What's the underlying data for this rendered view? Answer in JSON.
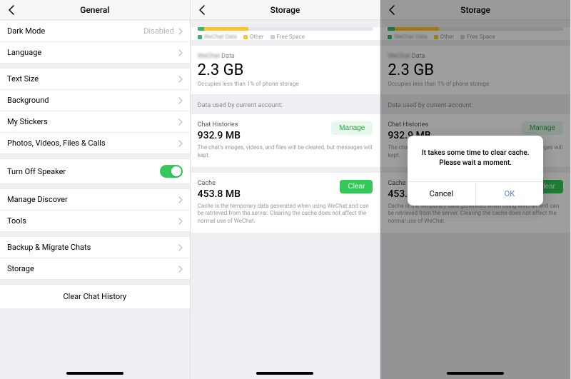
{
  "general": {
    "title": "General",
    "rows": {
      "darkMode": {
        "label": "Dark Mode",
        "value": "Disabled"
      },
      "language": {
        "label": "Language"
      },
      "textSize": {
        "label": "Text Size"
      },
      "background": {
        "label": "Background"
      },
      "myStickers": {
        "label": "My Stickers"
      },
      "photos": {
        "label": "Photos, Videos, Files & Calls"
      },
      "turnOffSpeaker": {
        "label": "Turn Off Speaker",
        "on": true
      },
      "manageDiscover": {
        "label": "Manage Discover"
      },
      "tools": {
        "label": "Tools"
      },
      "backup": {
        "label": "Backup & Migrate Chats"
      },
      "storage": {
        "label": "Storage"
      },
      "clearHistory": {
        "label": "Clear Chat History"
      }
    }
  },
  "storage": {
    "title": "Storage",
    "legend": {
      "app": "WeChat Data",
      "other": "Other",
      "free": "Free Space"
    },
    "dataTitlePrefix": "WeChat",
    "dataTitleSuffix": " Data",
    "total": "2.3 GB",
    "totalSub": "Occupies less than 1% of phone storage",
    "sectionHeader": "Data used by current account:",
    "chat": {
      "name": "Chat Histories",
      "value": "932.9 MB",
      "desc": "The chat's images, videos, and files will be cleared, but messages will kept.",
      "btn": "Manage"
    },
    "cache": {
      "name": "Cache",
      "value": "453.8 MB",
      "desc": "Cache is the temporary data generated when using WeChat and can be retrieved from the server. Clearing the cache does not affect the normal use of WeChat.",
      "btn": "Clear"
    }
  },
  "dialog": {
    "messageLine1": "It takes some time to clear cache.",
    "messageLine2": "Please wait a moment.",
    "cancel": "Cancel",
    "ok": "OK"
  }
}
